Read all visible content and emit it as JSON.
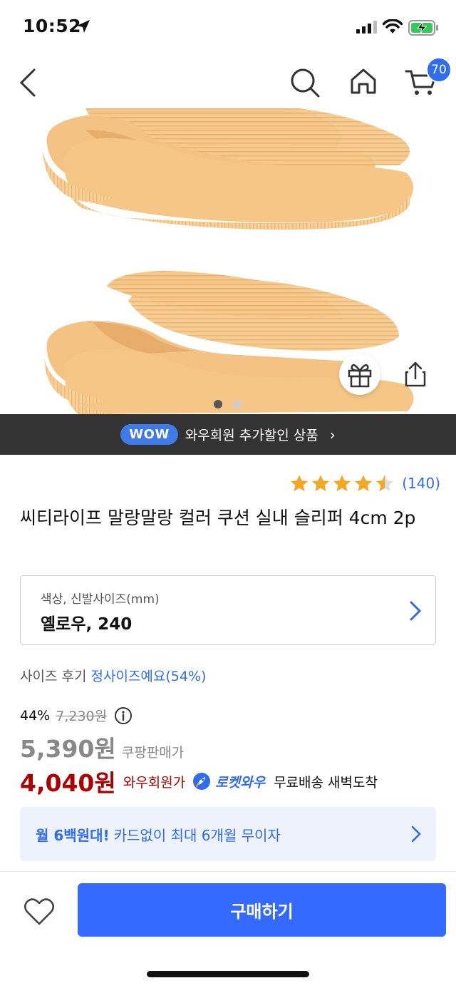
{
  "status_bar": {
    "time": "10:52"
  },
  "nav": {
    "cart_count": "70"
  },
  "product": {
    "image_dots": 2,
    "active_dot": 1
  },
  "wow_banner": {
    "badge": "WOW",
    "text": "와우회원 추가할인 상품",
    "chevron": "›"
  },
  "rating": {
    "stars": 4.5,
    "review_count": "(140)"
  },
  "title": "씨티라이프 말랑말랑 컬러 쿠션 실내 슬리퍼 4cm 2p",
  "option": {
    "label": "색상, 신발사이즈(mm)",
    "value": "옐로우, 240"
  },
  "size_review": {
    "label": "사이즈 후기",
    "highlight": "정사이즈예요(54%)"
  },
  "pricing": {
    "discount": "44%",
    "original_price": "7,230원",
    "sale_price": "5,390원",
    "sale_label": "쿠팡판매가",
    "wow_price": "4,040원",
    "wow_label": "와우회원가",
    "rocket_label": "로켓와우",
    "delivery": "무료배송 새벽도착"
  },
  "card_promo": {
    "bold_text": "월 6백원대!",
    "text": "카드없이 최대 6개월 무이자"
  },
  "bottom": {
    "buy_label": "구매하기"
  },
  "colors": {
    "accent_blue": "#346aff",
    "wow_red": "#ae0000",
    "star_gold": "#f5a623",
    "sandal": "#f7c98a"
  }
}
